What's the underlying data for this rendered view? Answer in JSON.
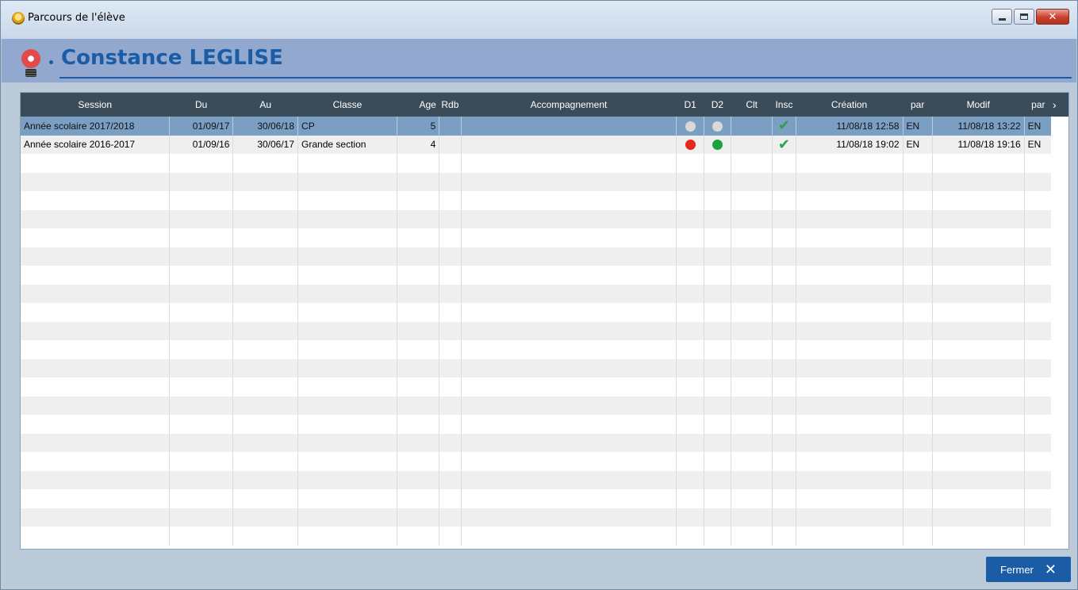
{
  "window": {
    "title": "Parcours de l'élève"
  },
  "header": {
    "person_name": "Constance LEGLISE"
  },
  "table": {
    "columns": [
      "Session",
      "Du",
      "Au",
      "Classe",
      "Age",
      "Rdb",
      "Accompagnement",
      "D1",
      "D2",
      "Clt",
      "Insc",
      "Création",
      "par",
      "Modif",
      "par"
    ],
    "rows": [
      {
        "session": "Année scolaire 2017/2018",
        "du": "01/09/17",
        "au": "30/06/18",
        "classe": "CP",
        "age": "5",
        "rdb": "",
        "accompagnement": "",
        "d1": "grey",
        "d2": "grey",
        "clt": "",
        "insc": true,
        "creation": "11/08/18 12:58",
        "par1": "EN",
        "modif": "11/08/18 13:22",
        "par2": "EN",
        "selected": true
      },
      {
        "session": "Année scolaire 2016-2017",
        "du": "01/09/16",
        "au": "30/06/17",
        "classe": "Grande section",
        "age": "4",
        "rdb": "",
        "accompagnement": "",
        "d1": "red",
        "d2": "green",
        "clt": "",
        "insc": true,
        "creation": "11/08/18 19:02",
        "par1": "EN",
        "modif": "11/08/18 19:16",
        "par2": "EN",
        "selected": false
      }
    ]
  },
  "footer": {
    "close_label": "Fermer"
  },
  "colors": {
    "accent": "#1a5da6",
    "header_bg": "#3a4b5a",
    "selected_row": "#7b9fc3",
    "dot_red": "#e8281e",
    "dot_green": "#1fa23e",
    "dot_grey": "#d9d9d9"
  }
}
